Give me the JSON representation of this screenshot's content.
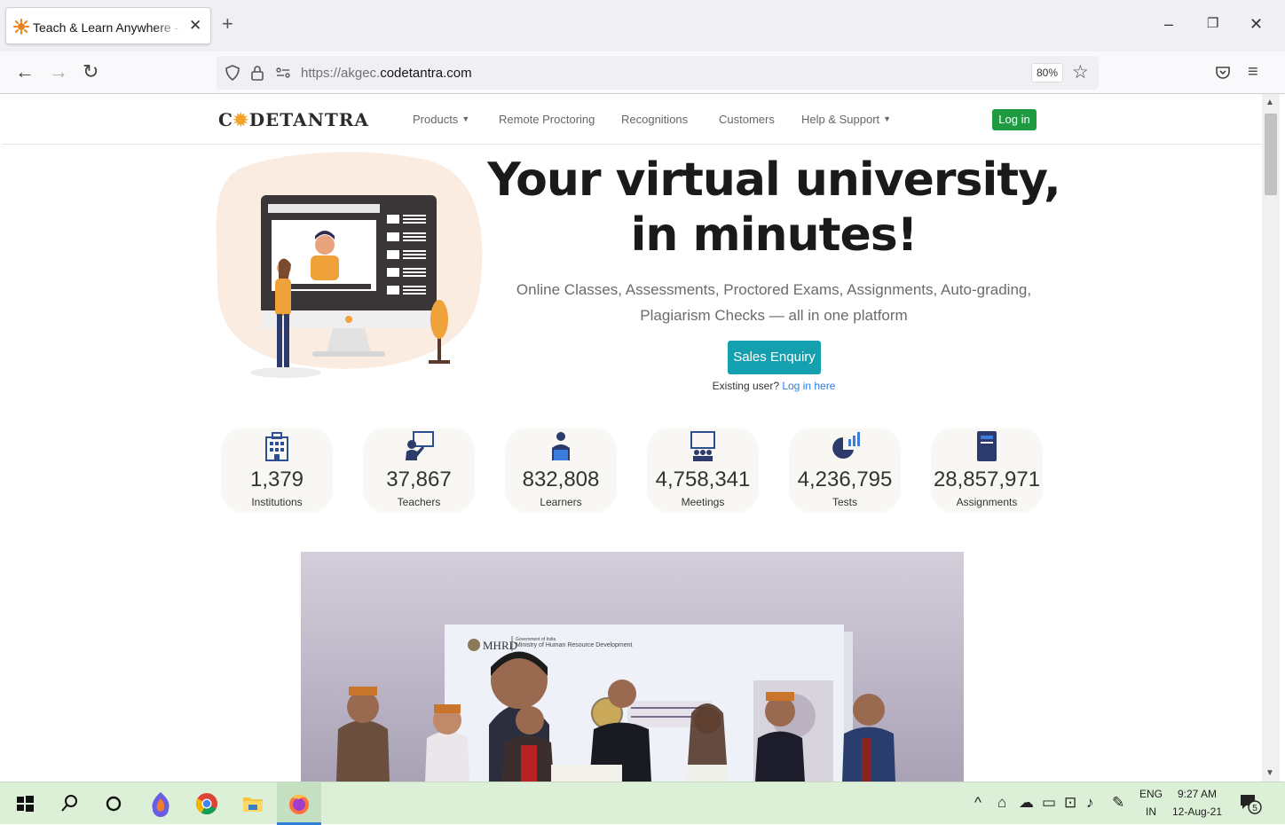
{
  "browser": {
    "tab_title": "Teach & Learn Anywhere - CodeTantra",
    "url_prefix": "https://akgec.",
    "url_domain": "codetantra.com",
    "zoom": "80%"
  },
  "site": {
    "logo": {
      "part1": "C",
      "part2": "DE",
      "part3": "TANTRA"
    },
    "menu": {
      "products": "Products",
      "remote_proctoring": "Remote Proctoring",
      "recognitions": "Recognitions",
      "customers": "Customers",
      "help_support": "Help & Support"
    },
    "login_label": "Log in"
  },
  "hero": {
    "title_line1": "Your virtual university,",
    "title_line2": "in minutes!",
    "subtitle": "Online Classes, Assessments, Proctored Exams, Assignments, Auto-grading, Plagiarism Checks — all in one platform",
    "cta": "Sales Enquiry",
    "existing_text": "Existing user? ",
    "existing_link": "Log in here"
  },
  "stats": [
    {
      "value": "1,379",
      "label": "Institutions",
      "icon": "building-icon"
    },
    {
      "value": "37,867",
      "label": "Teachers",
      "icon": "teacher-icon"
    },
    {
      "value": "832,808",
      "label": "Learners",
      "icon": "learner-icon"
    },
    {
      "value": "4,758,341",
      "label": "Meetings",
      "icon": "meeting-icon"
    },
    {
      "value": "4,236,795",
      "label": "Tests",
      "icon": "test-icon"
    },
    {
      "value": "28,857,971",
      "label": "Assignments",
      "icon": "assignment-icon"
    }
  ],
  "photo": {
    "banner_org": "MHRD",
    "banner_sub_line1": "Government of India",
    "banner_sub_line2": "Ministry of Human Resource Development"
  },
  "taskbar": {
    "lang_top": "ENG",
    "lang_bottom": "IN",
    "time": "9:27 AM",
    "date": "12-Aug-21",
    "notif_count": "5"
  },
  "colors": {
    "green": "#1e9b41",
    "teal": "#15a0b0",
    "link": "#2b7de9",
    "taskbar": "#dcf0d7"
  }
}
